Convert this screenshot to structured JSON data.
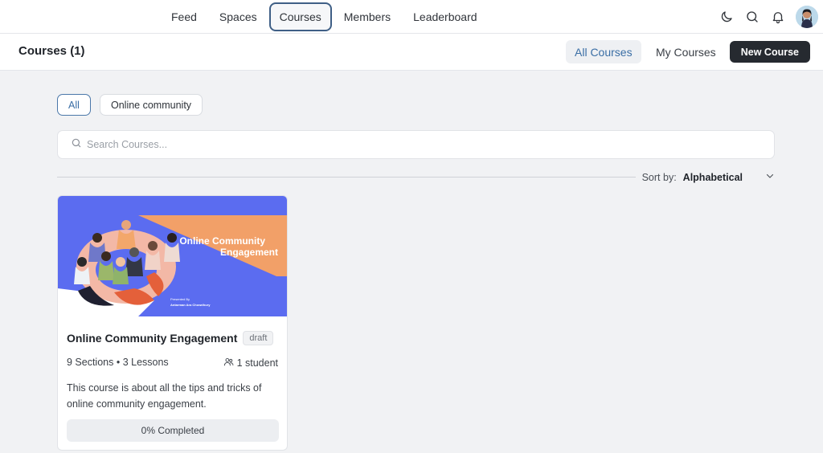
{
  "nav": {
    "items": [
      {
        "label": "Feed",
        "active": false
      },
      {
        "label": "Spaces",
        "active": false
      },
      {
        "label": "Courses",
        "active": true
      },
      {
        "label": "Members",
        "active": false
      },
      {
        "label": "Leaderboard",
        "active": false
      }
    ],
    "icons": [
      "moon-icon",
      "search-icon",
      "bell-icon"
    ]
  },
  "header": {
    "title": "Courses (1)",
    "tabs": [
      {
        "label": "All Courses",
        "active": true
      },
      {
        "label": "My Courses",
        "active": false
      }
    ],
    "new_button": "New Course"
  },
  "filters": {
    "chips": [
      {
        "label": "All",
        "active": true
      },
      {
        "label": "Online community",
        "active": false
      }
    ]
  },
  "search": {
    "placeholder": "Search Courses..."
  },
  "sort": {
    "label": "Sort by:",
    "value": "Alphabetical"
  },
  "courses": [
    {
      "title": "Online Community Engagement",
      "status": "draft",
      "sections_lessons": "9 Sections • 3 Lessons",
      "students": "1 student",
      "description": "This course is about all the tips and tricks of online community engagement.",
      "progress_label": "0% Completed",
      "progress": 0,
      "thumbnail": {
        "title_line1": "Online Community",
        "title_line2": "Engagement",
        "presented_by": "Presented By",
        "author": "Antarman Ara Chowdhury"
      }
    }
  ],
  "colors": {
    "accent": "#3a6ea5",
    "thumb_blue": "#5b6cf0",
    "thumb_orange": "#f2a068",
    "dark_button": "#262a30"
  }
}
